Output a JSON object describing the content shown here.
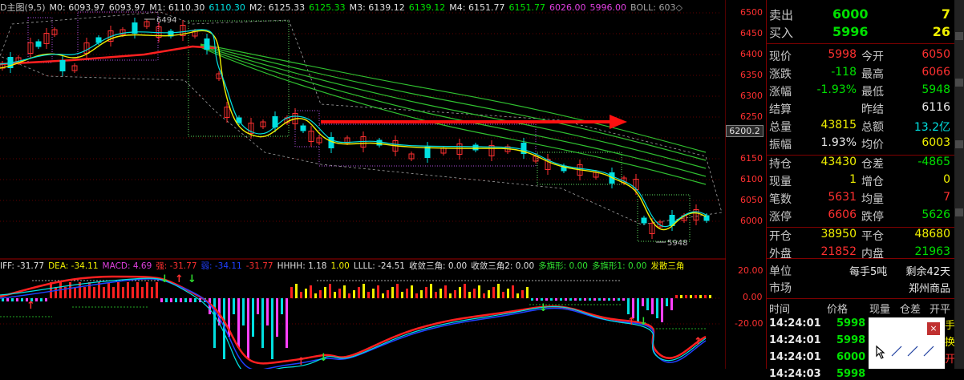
{
  "chart_header": {
    "title": "D主图(9,5)",
    "m0": "M0: 6093.97",
    "m0b": "6093.97",
    "m1": "M1: 6110.30",
    "m1b": "6110.30",
    "m2": "M2: 6125.33",
    "m2b": "6125.33",
    "m3": "M3: 6139.12",
    "m3b": "6139.12",
    "m4": "M4: 6151.77",
    "m4b": "6151.77",
    "v1": "6026.00",
    "v2": "5996.00",
    "boll": "BOLL: 603◇"
  },
  "macd_header": {
    "diff": "IFF: -31.77",
    "dea": "DEA: -34.11",
    "macd": "MACD: 4.69",
    "strong": "强: -31.77",
    "weak": "弱: -34.11",
    "v6": "-31.77",
    "hhhh": "HHHH: 1.18",
    "one": "1.00",
    "llll": "LLLL: -24.51",
    "sj": "收敛三角: 0.00",
    "sj2": "收敛三角2: 0.00",
    "dqx": "多旗形: 0.00",
    "dqx1": "多旗形1: 0.00",
    "fs": "发散三角"
  },
  "price_axis": [
    "6500",
    "6450",
    "6400",
    "6350",
    "6300",
    "6250",
    "6200",
    "6150",
    "6100",
    "6050",
    "6000"
  ],
  "current_price_tag": "6200.2",
  "macd_axis": [
    "20.00",
    "0.00",
    "-20.00"
  ],
  "annotations": {
    "high": "6494",
    "low": "5948"
  },
  "quote": {
    "sell_label": "卖出",
    "sell_price": "6000",
    "sell_qty": "7",
    "buy_label": "买入",
    "buy_price": "5996",
    "buy_qty": "26",
    "rows": [
      {
        "l1": "现价",
        "v1": "5998",
        "c1": "red",
        "l2": "今开",
        "v2": "6050",
        "c2": "red"
      },
      {
        "l1": "涨跌",
        "v1": "-118",
        "c1": "grn",
        "l2": "最高",
        "v2": "6066",
        "c2": "red"
      },
      {
        "l1": "涨幅",
        "v1": "-1.93%",
        "c1": "grn",
        "l2": "最低",
        "v2": "5948",
        "c2": "grn"
      },
      {
        "l1": "结算",
        "v1": "",
        "c1": "wht",
        "l2": "昨结",
        "v2": "6116",
        "c2": "wht"
      },
      {
        "l1": "总量",
        "v1": "43815",
        "c1": "yel",
        "l2": "总额",
        "v2": "13.2亿",
        "c2": "cyn"
      },
      {
        "l1": "振幅",
        "v1": "1.93%",
        "c1": "wht",
        "l2": "均价",
        "v2": "6003",
        "c2": "yel"
      },
      {
        "l1": "持仓",
        "v1": "43430",
        "c1": "yel",
        "l2": "仓差",
        "v2": "-4865",
        "c2": "grn"
      },
      {
        "l1": "现量",
        "v1": "1",
        "c1": "yel",
        "l2": "增仓",
        "v2": "0",
        "c2": "yel"
      },
      {
        "l1": "笔数",
        "v1": "5631",
        "c1": "red",
        "l2": "均量",
        "v2": "7",
        "c2": "red"
      },
      {
        "l1": "涨停",
        "v1": "6606",
        "c1": "red",
        "l2": "跌停",
        "v2": "5626",
        "c2": "grn"
      },
      {
        "l1": "开仓",
        "v1": "38950",
        "c1": "yel",
        "l2": "平仓",
        "v2": "48680",
        "c2": "yel"
      },
      {
        "l1": "外盘",
        "v1": "21852",
        "c1": "red",
        "l2": "内盘",
        "v2": "21963",
        "c2": "grn"
      }
    ],
    "unit_label": "单位",
    "unit_value": "每手5吨",
    "days_left": "剩余42天",
    "market_label": "市场",
    "market_value": "郑州商品",
    "tick_headers": [
      "时间",
      "价格",
      "现量",
      "仓差",
      "开平"
    ],
    "ticks": [
      {
        "time": "14:24:01",
        "price": "5998"
      },
      {
        "time": "14:24:01",
        "price": "5998"
      },
      {
        "time": "14:24:01",
        "price": "6000"
      },
      {
        "time": "14:24:03",
        "price": "5998"
      }
    ],
    "tick_right": [
      "手",
      "换",
      "开"
    ]
  },
  "colors": {
    "up": "#ff3030",
    "down": "#00e0e0",
    "grid": "#800000",
    "ma_yellow": "#f0f000"
  }
}
